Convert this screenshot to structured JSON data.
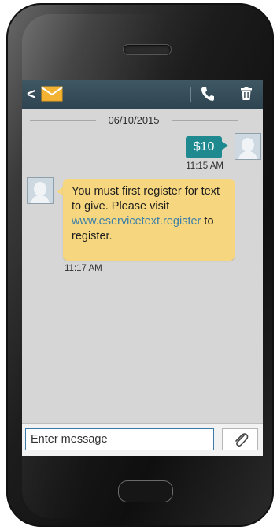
{
  "header": {
    "back_label": "<"
  },
  "conversation": {
    "date": "06/10/2015",
    "messages": [
      {
        "direction": "sent",
        "text": "$10",
        "time": "11:15 AM"
      },
      {
        "direction": "received",
        "text_before_link": "You must first register for text to give. Please visit ",
        "link": "www.eservicetext.register",
        "text_after_link": " to register.",
        "time": "11:17 AM"
      }
    ]
  },
  "composer": {
    "placeholder": "Enter message"
  },
  "icons": {
    "back": "chevron-left-icon",
    "app": "envelope-icon",
    "call": "phone-icon",
    "delete": "trash-icon",
    "attach": "paperclip-icon"
  },
  "colors": {
    "topbar": "#2e4450",
    "sent_bubble": "#1e8a90",
    "received_bubble": "#f6d77f",
    "link": "#3d7fa8",
    "input_border": "#3b79a8"
  }
}
